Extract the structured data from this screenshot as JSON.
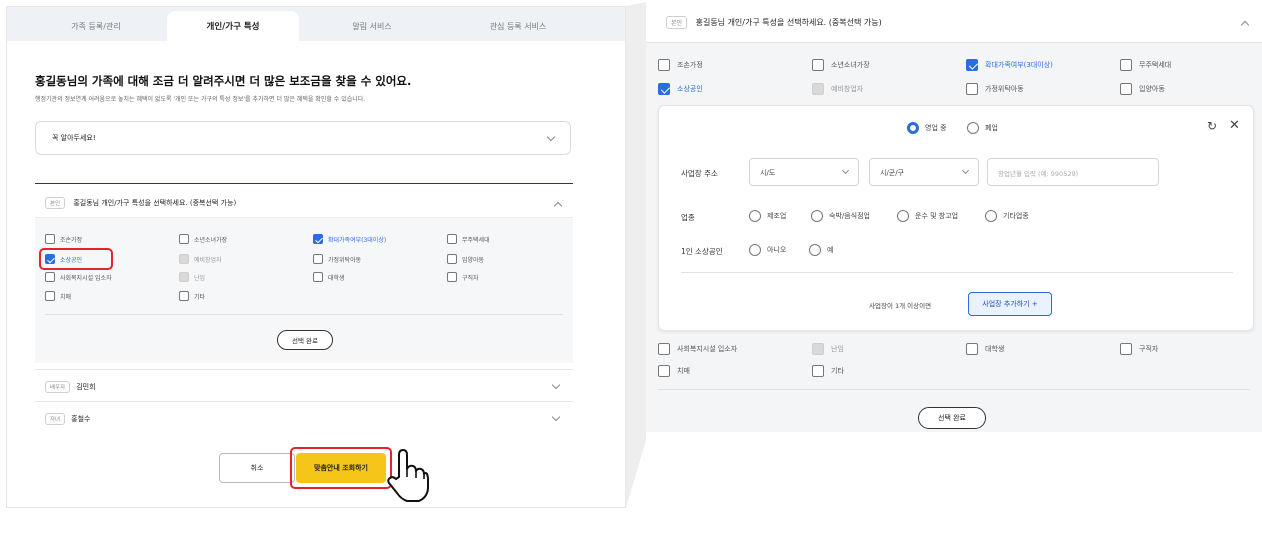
{
  "left": {
    "tabs": [
      {
        "label": "가족 등록/관리"
      },
      {
        "label": "개인/가구 특성"
      },
      {
        "label": "알림 서비스"
      },
      {
        "label": "관심 등록 서비스"
      }
    ],
    "headline": "홍길동님의 가족에 대해 조금 더 알려주시면 더 많은 보조금을 찾을 수 있어요.",
    "subline": "행정기관의 정보연계 어려움으로 놓치는 혜택이 없도록 '개인 또는 가구의 특성 정보'를 추가하면 더 많은 혜택을 확인할 수 있습니다.",
    "notice": "꼭 알아두세요!",
    "section": {
      "tag": "본인",
      "title": "홍길동님 개인/가구 특성을 선택하세요. (중복선택 가능)",
      "options": [
        {
          "label": "조손가정",
          "state": "off"
        },
        {
          "label": "소년소녀가장",
          "state": "off"
        },
        {
          "label": "확대가족여부(3대이상)",
          "state": "on"
        },
        {
          "label": "무주택세대",
          "state": "off"
        },
        {
          "label": "소상공인",
          "state": "on"
        },
        {
          "label": "예비창업자",
          "state": "disabled"
        },
        {
          "label": "가정위탁아동",
          "state": "off"
        },
        {
          "label": "입양아동",
          "state": "off"
        },
        {
          "label": "사회복지시설 입소자",
          "state": "off"
        },
        {
          "label": "난임",
          "state": "disabled"
        },
        {
          "label": "대학생",
          "state": "off"
        },
        {
          "label": "구직자",
          "state": "off"
        },
        {
          "label": "치매",
          "state": "off"
        },
        {
          "label": "기타",
          "state": "off"
        }
      ],
      "done_label": "선택 완료"
    },
    "persons": [
      {
        "tag": "배우자",
        "name": "김민희"
      },
      {
        "tag": "자녀",
        "name": "홍철수"
      }
    ],
    "cancel_label": "취소",
    "submit_label": "맞춤안내 조회하기"
  },
  "right": {
    "tag": "본인",
    "title": "홍길동님 개인/가구 특성을 선택하세요. (중복선택 가능)",
    "options_top": [
      {
        "label": "조손가정",
        "state": "off"
      },
      {
        "label": "소년소녀가장",
        "state": "off"
      },
      {
        "label": "확대가족여부(3대이상)",
        "state": "on"
      },
      {
        "label": "무주택세대",
        "state": "off"
      },
      {
        "label": "소상공인",
        "state": "on"
      },
      {
        "label": "예비창업자",
        "state": "disabled"
      },
      {
        "label": "가정위탁아동",
        "state": "off"
      },
      {
        "label": "입양아동",
        "state": "off"
      }
    ],
    "card": {
      "status": {
        "open": "영업 중",
        "closed": "폐업",
        "selected": "open"
      },
      "address_label": "사업장 주소",
      "sido": "시/도",
      "sigungu": "시/군/구",
      "open_date_placeholder": "창업년월 입력 (예: 990529)",
      "industry_label": "업종",
      "industries": [
        "제조업",
        "숙박/음식점업",
        "운수 및 창고업",
        "기타업종"
      ],
      "solo_label": "1인 소상공인",
      "solo_options": [
        "아니오",
        "예"
      ],
      "add_hint": "사업장이 1개 이상이면",
      "add_label": "사업장 추가하기 +"
    },
    "options_bottom": [
      {
        "label": "사회복지시설 입소자",
        "state": "off"
      },
      {
        "label": "난임",
        "state": "disabled"
      },
      {
        "label": "대학생",
        "state": "off"
      },
      {
        "label": "구직자",
        "state": "off"
      },
      {
        "label": "치매",
        "state": "off"
      },
      {
        "label": "기타",
        "state": "off"
      }
    ],
    "done_label": "선택 완료"
  },
  "colors": {
    "accent": "#2a6de0",
    "highlight": "#e3242b",
    "submit": "#f5c518",
    "navy": "#1f3a6b"
  }
}
